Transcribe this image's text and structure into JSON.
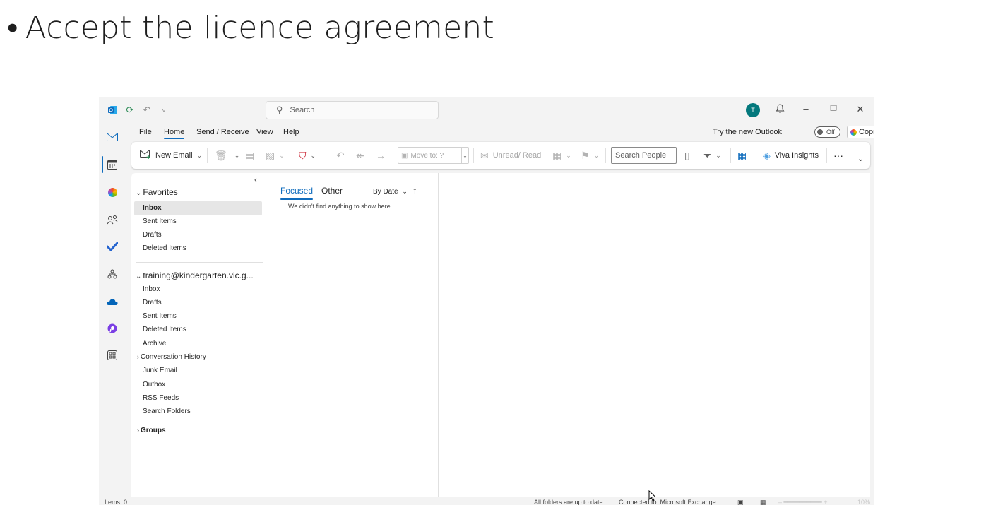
{
  "slide": {
    "bullet": "•",
    "text": "Accept the licence agreement"
  },
  "titlebar": {
    "search_placeholder": "Search",
    "avatar_initial": "T",
    "icons": [
      "outlook-logo-icon",
      "sync-icon",
      "undo-icon",
      "customize-qat-icon",
      "bell-icon",
      "minimize-icon",
      "restore-icon",
      "close-icon"
    ]
  },
  "menu": {
    "items": [
      "File",
      "Home",
      "Send / Receive",
      "View",
      "Help"
    ],
    "active": "Home",
    "try_new": "Try the new Outlook",
    "toggle_state": "Off",
    "copilot": "Copilot"
  },
  "ribbon": {
    "new_email": "New Email",
    "move_to": "Move to: ?",
    "unread_read": "Unread/ Read",
    "search_people": "Search People",
    "viva": "Viva Insights",
    "more": "···"
  },
  "folders": {
    "favorites_header": "Favorites",
    "favorites": [
      "Inbox",
      "Sent Items",
      "Drafts",
      "Deleted Items"
    ],
    "account_header": "training@kindergarten.vic.g...",
    "account_folders": [
      "Inbox",
      "Drafts",
      "Sent Items",
      "Deleted Items",
      "Archive",
      "Conversation History",
      "Junk Email",
      "Outbox",
      "RSS Feeds",
      "Search Folders"
    ],
    "groups_header": "Groups"
  },
  "list": {
    "tab_focused": "Focused",
    "tab_other": "Other",
    "sort_by": "By Date",
    "empty_message": "We didn't find anything to show here."
  },
  "status": {
    "items": "Items: 0",
    "sync": "All folders are up to date.",
    "connection": "Connected to: Microsoft Exchange",
    "zoom": "10%"
  },
  "colors": {
    "accent": "#0f6cbd",
    "avatar": "#03787c"
  }
}
